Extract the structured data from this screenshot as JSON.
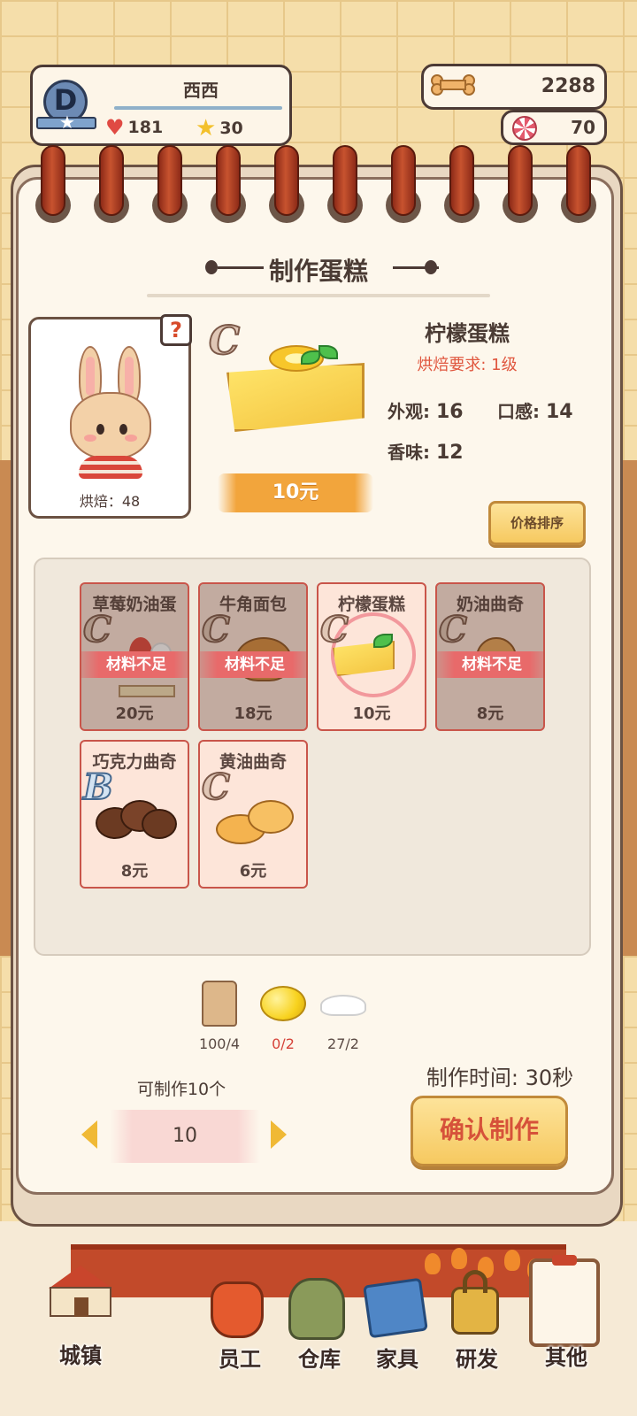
{
  "player": {
    "name": "西西",
    "rank": "D",
    "hearts": "181",
    "stars": "30"
  },
  "currency": {
    "bones": "2288",
    "candy": "70"
  },
  "title": "制作蛋糕",
  "baker": {
    "help": "?",
    "stat": "烘焙：48"
  },
  "selected": {
    "grade": "C",
    "name": "柠檬蛋糕",
    "requirement": "烘焙要求: 1级",
    "price": "10元",
    "appearance_label": "外观:",
    "appearance": "16",
    "taste_label": "口感:",
    "taste": "14",
    "aroma_label": "香味:",
    "aroma": "12"
  },
  "sort_button": "价格排序",
  "insufficient_label": "材料不足",
  "recipes": [
    {
      "name": "草莓奶油蛋",
      "grade": "C",
      "price": "20元",
      "insufficient": true
    },
    {
      "name": "牛角面包",
      "grade": "C",
      "price": "18元",
      "insufficient": true
    },
    {
      "name": "柠檬蛋糕",
      "grade": "C",
      "price": "10元",
      "insufficient": false,
      "selected": true
    },
    {
      "name": "奶油曲奇",
      "grade": "C",
      "price": "8元",
      "insufficient": true
    },
    {
      "name": "巧克力曲奇",
      "grade": "B",
      "price": "8元",
      "insufficient": false
    },
    {
      "name": "黄油曲奇",
      "grade": "C",
      "price": "6元",
      "insufficient": false
    }
  ],
  "ingredients": [
    {
      "icon": "flour-bag-icon",
      "count": "100/4",
      "color": "#5a4a44"
    },
    {
      "icon": "lemon-icon",
      "count": "0/2",
      "color": "#d6433a"
    },
    {
      "icon": "sugar-icon",
      "count": "27/2",
      "color": "#5a4a44"
    }
  ],
  "can_make": "可制作10个",
  "quantity": "10",
  "make_time": "制作时间: 30秒",
  "confirm": "确认制作",
  "nav": {
    "town": "城镇",
    "staff": "员工",
    "warehouse": "仓库",
    "furniture": "家具",
    "research": "研发",
    "other": "其他"
  },
  "colors": {
    "accent": "#f6c960",
    "warning": "#e86a6a",
    "outline": "#4c3a35"
  }
}
